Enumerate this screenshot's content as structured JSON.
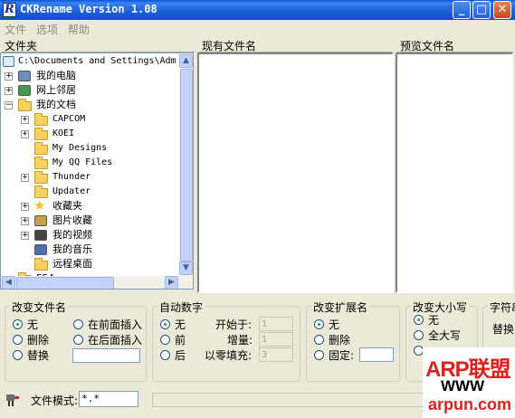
{
  "window": {
    "title": "CKRename Version 1.08",
    "icon_letter": "R"
  },
  "title_buttons": {
    "minimize": "_",
    "maximize": "□",
    "close": "✕"
  },
  "menu": [
    "文件",
    "选项",
    "帮助"
  ],
  "panels": {
    "folders": "文件夹",
    "current_files": "现有文件名",
    "preview_files": "预览文件名"
  },
  "tree": {
    "path": "C:\\Documents and Settings\\Adm",
    "items": [
      {
        "label": "我的电脑",
        "icon": "computer-icon",
        "expandable": true,
        "level": 1
      },
      {
        "label": "网上邻居",
        "icon": "network-icon",
        "expandable": true,
        "level": 1
      },
      {
        "label": "我的文档",
        "icon": "documents-icon",
        "expandable": true,
        "expanded": true,
        "level": 1
      },
      {
        "label": "CAPCOM",
        "icon": "folder-icon",
        "expandable": true,
        "level": 2,
        "mono": true
      },
      {
        "label": "KOEI",
        "icon": "folder-icon",
        "expandable": true,
        "level": 2,
        "mono": true
      },
      {
        "label": "My Designs",
        "icon": "folder-icon",
        "expandable": false,
        "level": 2,
        "mono": true
      },
      {
        "label": "My QQ Files",
        "icon": "folder-icon",
        "expandable": false,
        "level": 2,
        "mono": true
      },
      {
        "label": "Thunder",
        "icon": "folder-icon",
        "expandable": true,
        "level": 2,
        "mono": true
      },
      {
        "label": "Updater",
        "icon": "folder-icon",
        "expandable": false,
        "level": 2,
        "mono": true
      },
      {
        "label": "收藏夹",
        "icon": "star-icon",
        "expandable": true,
        "level": 2
      },
      {
        "label": "图片收藏",
        "icon": "pictures-icon",
        "expandable": true,
        "level": 2
      },
      {
        "label": "我的视频",
        "icon": "video-icon",
        "expandable": true,
        "level": 2
      },
      {
        "label": "我的音乐",
        "icon": "music-icon",
        "expandable": false,
        "level": 2
      },
      {
        "label": "远程桌面",
        "icon": "folder-icon",
        "expandable": false,
        "level": 2
      },
      {
        "label": "FSA",
        "icon": "folder-icon",
        "expandable": false,
        "level": 1,
        "partial": true
      }
    ]
  },
  "group_rename": {
    "title": "改变文件名",
    "options": [
      "无",
      "删除",
      "替换",
      "在前面插入",
      "在后面插入"
    ],
    "selected": "无"
  },
  "group_autonum": {
    "title": "自动数字",
    "options": [
      "无",
      "前",
      "后"
    ],
    "selected": "无",
    "fields": [
      {
        "label": "开始于:",
        "value": "1"
      },
      {
        "label": "增量:",
        "value": "1"
      },
      {
        "label": "以零填充:",
        "value": "3"
      }
    ]
  },
  "group_ext": {
    "title": "改变扩展名",
    "options": [
      "无",
      "删除",
      "固定:"
    ],
    "selected": "无"
  },
  "group_case": {
    "title": "改变大小写",
    "options": [
      "无",
      "全大写"
    ],
    "selected": "无"
  },
  "group_chars": {
    "title": "字符串",
    "option": "替换"
  },
  "footer": {
    "file_mode_label": "文件模式:",
    "file_mode_value": "*.*"
  },
  "watermark": {
    "brand": "ARP联盟",
    "www": "WWW",
    "domain": "arpun.com"
  },
  "colors": {
    "titlebar": "#1E64E0",
    "close_button": "#C44A1C",
    "watermark_red": "#E0201B"
  }
}
